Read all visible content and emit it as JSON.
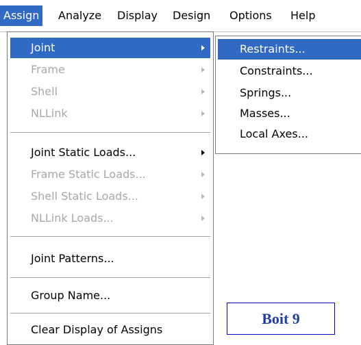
{
  "menubar": {
    "items": [
      "Assign",
      "Analyze",
      "Display",
      "Design",
      "Options",
      "Help"
    ],
    "active": "Assign"
  },
  "assign_menu": {
    "items": [
      {
        "label": "Joint",
        "enabled": true,
        "submenu": true,
        "highlighted": true
      },
      {
        "label": "Frame",
        "enabled": false,
        "submenu": true
      },
      {
        "label": "Shell",
        "enabled": false,
        "submenu": true
      },
      {
        "label": "NLLink",
        "enabled": false,
        "submenu": true
      },
      {
        "label": "Joint Static Loads...",
        "enabled": true,
        "submenu": true
      },
      {
        "label": "Frame Static Loads...",
        "enabled": false,
        "submenu": true
      },
      {
        "label": "Shell Static Loads...",
        "enabled": false,
        "submenu": true
      },
      {
        "label": "NLLink Loads...",
        "enabled": false,
        "submenu": true
      },
      {
        "label": "Joint Patterns...",
        "enabled": true,
        "submenu": false
      },
      {
        "label": "Group Name...",
        "enabled": true,
        "submenu": false
      },
      {
        "label": "Clear Display of Assigns",
        "enabled": true,
        "submenu": false
      }
    ]
  },
  "joint_submenu": {
    "items": [
      "Restraints...",
      "Constraints...",
      "Springs...",
      "Masses...",
      "Local Axes..."
    ],
    "highlighted": "Restraints..."
  },
  "caption_box": {
    "text": "Boit 9"
  },
  "colors": {
    "highlight": "#316ac5",
    "disabled_text": "#a8a8a8",
    "caption_text": "#1f3fa6",
    "caption_border": "#0000cc"
  }
}
